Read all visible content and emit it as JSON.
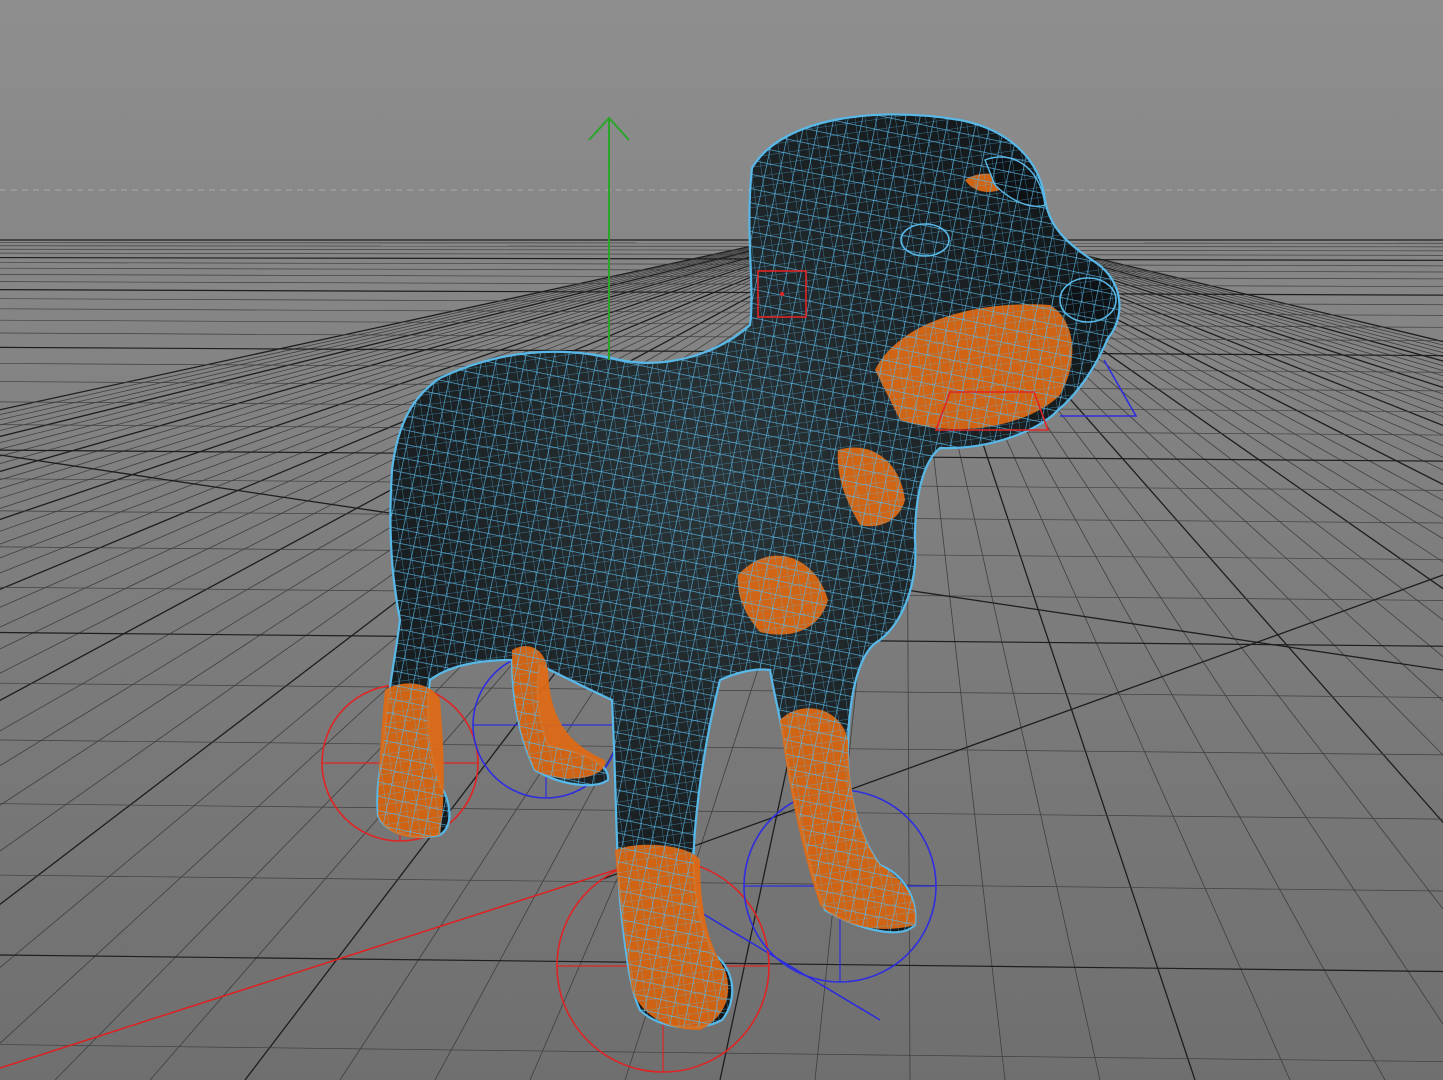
{
  "viewport": {
    "kind": "3d-perspective-viewport",
    "background_top": "#8e8e8e",
    "background_bottom": "#6f6f6f",
    "grid_color": "#3f3f3f",
    "grid_major_color": "#1e1e1e",
    "horizon_line_color": "#a9a9a9"
  },
  "object": {
    "name": "rigged-dog-model",
    "display_mode": "wireframe-on-shaded",
    "wire_color": "#58b8e8",
    "body_color": "#16191c",
    "marking_color": "#e06a14"
  },
  "gizmo": {
    "y_axis_color": "#2aa52a",
    "x_axis_color": "#e02020",
    "z_axis_color": "#2a2ae0"
  },
  "controls": {
    "foot_controls": [
      {
        "name": "foot-control-back-left",
        "color": "#e02424"
      },
      {
        "name": "foot-control-back-right",
        "color": "#2e2ee0"
      },
      {
        "name": "foot-control-front-left",
        "color": "#e02424"
      },
      {
        "name": "foot-control-front-right",
        "color": "#2e2ee0"
      }
    ],
    "head_control_color": "#e02424",
    "jaw_control_color": "#e02424",
    "head_aim_control_color": "#2e2ee0"
  }
}
